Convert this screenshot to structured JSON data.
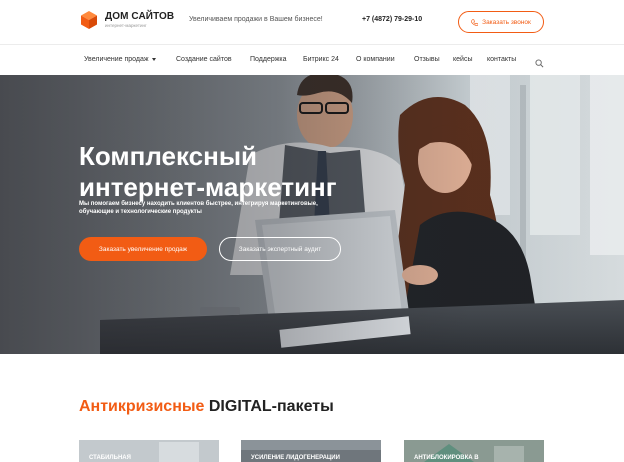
{
  "header": {
    "logo_title": "ДОМ САЙТОВ",
    "logo_subtitle": "интернет-маркетинг",
    "tagline": "Увеличиваем продажи в Вашем бизнесе!",
    "phone": "+7 (4872) 79-29-10",
    "call_button": "Заказать звонок"
  },
  "nav": {
    "items": [
      {
        "label": "Увеличение продаж",
        "has_dropdown": true
      },
      {
        "label": "Создание сайтов"
      },
      {
        "label": "Поддержка"
      },
      {
        "label": "Битрикс 24"
      },
      {
        "label": "О компании"
      },
      {
        "label": "Отзывы"
      },
      {
        "label": "кейсы"
      },
      {
        "label": "контакты"
      }
    ],
    "search_icon": "search-icon"
  },
  "hero": {
    "title_line1": "Комплексный",
    "title_line2": "интернет-маркетинг",
    "subtitle": "Мы помогаем бизнесу находить клиентов быстрее, интегрируя маркетинговые, обучающие и технологические продукты",
    "primary_button": "Заказать увеличение продаж",
    "secondary_button": "Заказать экспертный аудит"
  },
  "packages": {
    "title_accent": "Антикризисные",
    "title_rest": "DIGITAL-пакеты",
    "cards": [
      {
        "label": "Стабильная"
      },
      {
        "label": "Усиление лидогенерации"
      },
      {
        "label": "Антиблокировка в"
      }
    ]
  },
  "colors": {
    "accent": "#f25c14",
    "text": "#222222"
  }
}
